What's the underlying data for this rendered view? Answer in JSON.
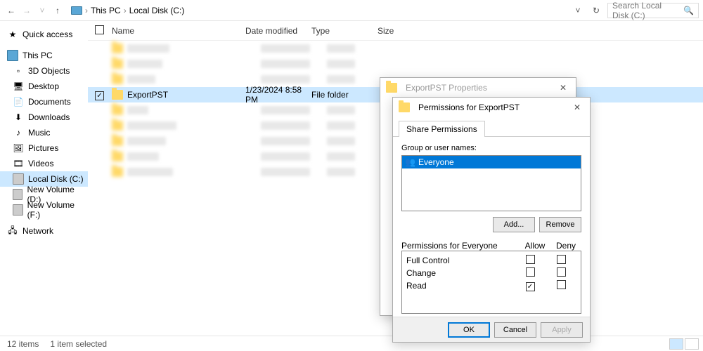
{
  "breadcrumb": {
    "root": "This PC",
    "drive": "Local Disk (C:)"
  },
  "search_placeholder": "Search Local Disk (C:)",
  "columns": {
    "name": "Name",
    "date": "Date modified",
    "type": "Type",
    "size": "Size"
  },
  "sidebar": {
    "quick": "Quick access",
    "thispc": "This PC",
    "items": [
      "3D Objects",
      "Desktop",
      "Documents",
      "Downloads",
      "Music",
      "Pictures",
      "Videos",
      "Local Disk (C:)",
      "New Volume (D:)",
      "New Volume (F:)"
    ],
    "network": "Network"
  },
  "selected_row": {
    "name": "ExportPST",
    "date": "1/23/2024 8:58 PM",
    "type": "File folder"
  },
  "status": {
    "items": "12 items",
    "selected": "1 item selected"
  },
  "dialog_properties": {
    "title": "ExportPST Properties"
  },
  "dialog_permissions": {
    "title": "Permissions for ExportPST",
    "tab": "Share Permissions",
    "group_label": "Group or user names:",
    "user": "Everyone",
    "add": "Add...",
    "remove": "Remove",
    "perm_label": "Permissions for Everyone",
    "allow": "Allow",
    "deny": "Deny",
    "rows": [
      {
        "name": "Full Control",
        "allow": false,
        "deny": false
      },
      {
        "name": "Change",
        "allow": false,
        "deny": false
      },
      {
        "name": "Read",
        "allow": true,
        "deny": false
      }
    ],
    "ok": "OK",
    "cancel": "Cancel",
    "apply": "Apply"
  }
}
